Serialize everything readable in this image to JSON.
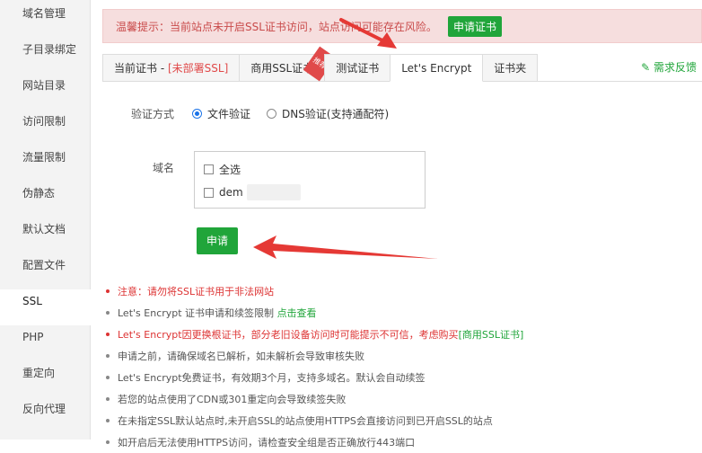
{
  "sidebar": {
    "items": [
      {
        "label": "域名管理"
      },
      {
        "label": "子目录绑定"
      },
      {
        "label": "网站目录"
      },
      {
        "label": "访问限制"
      },
      {
        "label": "流量限制"
      },
      {
        "label": "伪静态"
      },
      {
        "label": "默认文档"
      },
      {
        "label": "配置文件"
      },
      {
        "label": "SSL"
      },
      {
        "label": "PHP"
      },
      {
        "label": "重定向"
      },
      {
        "label": "反向代理"
      }
    ],
    "active_index": 8
  },
  "alert": {
    "text": "温馨提示：当前站点未开启SSL证书访问，站点访问可能存在风险。",
    "button": "申请证书"
  },
  "tabs": {
    "current_prefix": "当前证书 - ",
    "current_status": "[未部署SSL]",
    "commercial": "商用SSL证书",
    "commercial_badge": "推荐",
    "test": "测试证书",
    "letsencrypt": "Let's Encrypt",
    "folder": "证书夹",
    "feedback": "需求反馈"
  },
  "form": {
    "verify_label": "验证方式",
    "file_verify": "文件验证",
    "dns_verify": "DNS验证(支持通配符)",
    "domain_label": "域名",
    "select_all": "全选",
    "domain_item": "dem",
    "apply": "申请"
  },
  "tips": {
    "t1": "注意：请勿将SSL证书用于非法网站",
    "t2": "Let's Encrypt 证书申请和续签限制",
    "t2_link": "点击查看",
    "t3": "Let's Encrypt因更换根证书，部分老旧设备访问时可能提示不可信，考虑购买",
    "t3_link": "[商用SSL证书]",
    "t4": "申请之前，请确保域名已解析，如未解析会导致审核失败",
    "t5": "Let's Encrypt免费证书，有效期3个月，支持多域名。默认会自动续签",
    "t6": "若您的站点使用了CDN或301重定向会导致续签失败",
    "t7": "在未指定SSL默认站点时,未开启SSL的站点使用HTTPS会直接访问到已开启SSL的站点",
    "t8": "如开启后无法使用HTTPS访问，请检查安全组是否正确放行443端口"
  },
  "colors": {
    "accent_green": "#20a53a",
    "warning_red": "#d33",
    "alert_bg": "#f6dede"
  }
}
